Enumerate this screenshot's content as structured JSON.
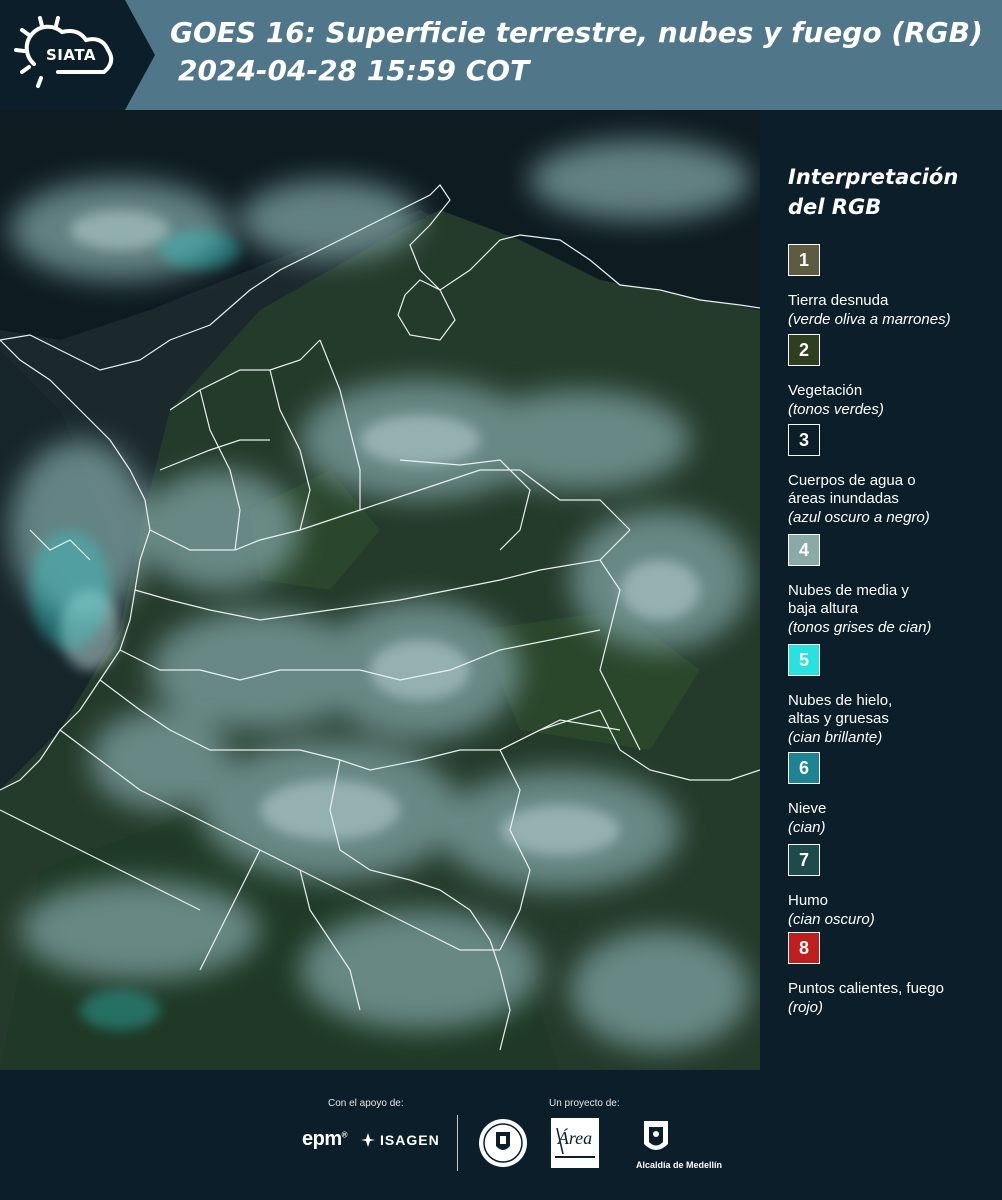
{
  "header": {
    "logo_text": "SIATA",
    "title_line1": "GOES 16: Superficie terrestre, nubes y fuego (RGB)",
    "title_line2": "2024-04-28 15:59 COT"
  },
  "legend": {
    "title": "Interpretación del RGB",
    "items": [
      {
        "number": "1",
        "color": "#5d5c41",
        "label": "Tierra desnuda",
        "desc": "(verde oliva a marrones)"
      },
      {
        "number": "2",
        "color": "#2e3f1f",
        "label": "Vegetación",
        "desc": "(tonos verdes)"
      },
      {
        "number": "3",
        "color": "#0b1e29",
        "label": "Cuerpos de agua o áreas inundadas",
        "desc": "(azul oscuro a negro)"
      },
      {
        "number": "4",
        "color": "#8aaaa9",
        "label": "Nubes de media y baja altura",
        "desc": "(tonos grises de cian)"
      },
      {
        "number": "5",
        "color": "#27e2e0",
        "label": "Nubes de hielo, altas y gruesas",
        "desc": "(cian brillante)"
      },
      {
        "number": "6",
        "color": "#1c8494",
        "label": "Nieve",
        "desc": "(cian)"
      },
      {
        "number": "7",
        "color": "#1d4a4a",
        "label": "Humo",
        "desc": "(cian oscuro)"
      },
      {
        "number": "8",
        "color": "#bf1e1e",
        "label": "Puntos calientes, fuego",
        "desc": "(rojo)"
      }
    ]
  },
  "footer": {
    "support_label": "Con el apoyo de:",
    "project_label": "Un proyecto de:",
    "epm": "epm",
    "isagen": "ISAGEN",
    "area_metropolitana": "Área",
    "alcaldia": "Alcaldía de Medellín"
  },
  "colors": {
    "header_bg": "#4f7789",
    "logo_bg": "#0b1e29",
    "panel_bg": "#0b1e29"
  }
}
